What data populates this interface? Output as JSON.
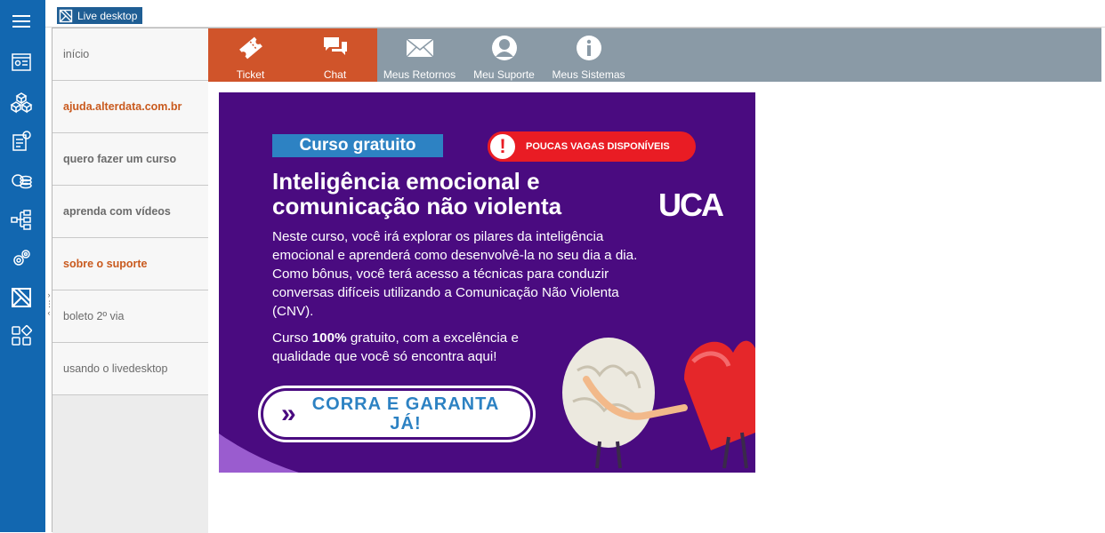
{
  "window": {
    "title": "Live desktop"
  },
  "rail": {
    "icons": [
      "menu-icon",
      "contacts-card-icon",
      "cubes-icon",
      "billing-icon",
      "coins-icon",
      "sitemap-icon",
      "settings-gears-icon",
      "live-desktop-logo-icon",
      "apps-grid-icon"
    ]
  },
  "nav": {
    "items": [
      {
        "label": "início"
      },
      {
        "label": "ajuda.alterdata.com.br"
      },
      {
        "label": "quero fazer um curso"
      },
      {
        "label": "aprenda com vídeos"
      },
      {
        "label": "sobre o suporte"
      },
      {
        "label": "boleto 2º via"
      },
      {
        "label": "usando o livedesktop"
      }
    ]
  },
  "toolbar": {
    "ticket": "Ticket",
    "chat": "Chat",
    "retornos": "Meus Retornos",
    "suporte": "Meu Suporte",
    "sistemas": "Meus Sistemas"
  },
  "banner": {
    "tag": "Curso gratuito",
    "alert": "POUCAS VAGAS DISPONÍVEIS",
    "headline": "Inteligência emocional e comunicação não violenta",
    "logo": "UCA",
    "description": "Neste curso, você irá explorar os pilares da inteligência emocional e aprenderá como desenvolvê-la no seu dia a dia. Como bônus, você terá acesso a técnicas para conduzir conversas difíceis utilizando a Comunicação Não Violenta (CNV).",
    "free_prefix": "Curso ",
    "free_bold": "100%",
    "free_suffix": " gratuito, com a excelência e qualidade que você só encontra aqui!",
    "cta_line1": "CORRA E GARANTA",
    "cta_line2": "JÁ!"
  },
  "colors": {
    "rail": "#1267b0",
    "toolbar": "#8a9aa6",
    "active_tab": "#d0542a",
    "banner_bg": "#4a0b80",
    "accent_blue": "#2d82c3",
    "alert_red": "#e91c24",
    "nav_orange": "#c95a1e"
  }
}
